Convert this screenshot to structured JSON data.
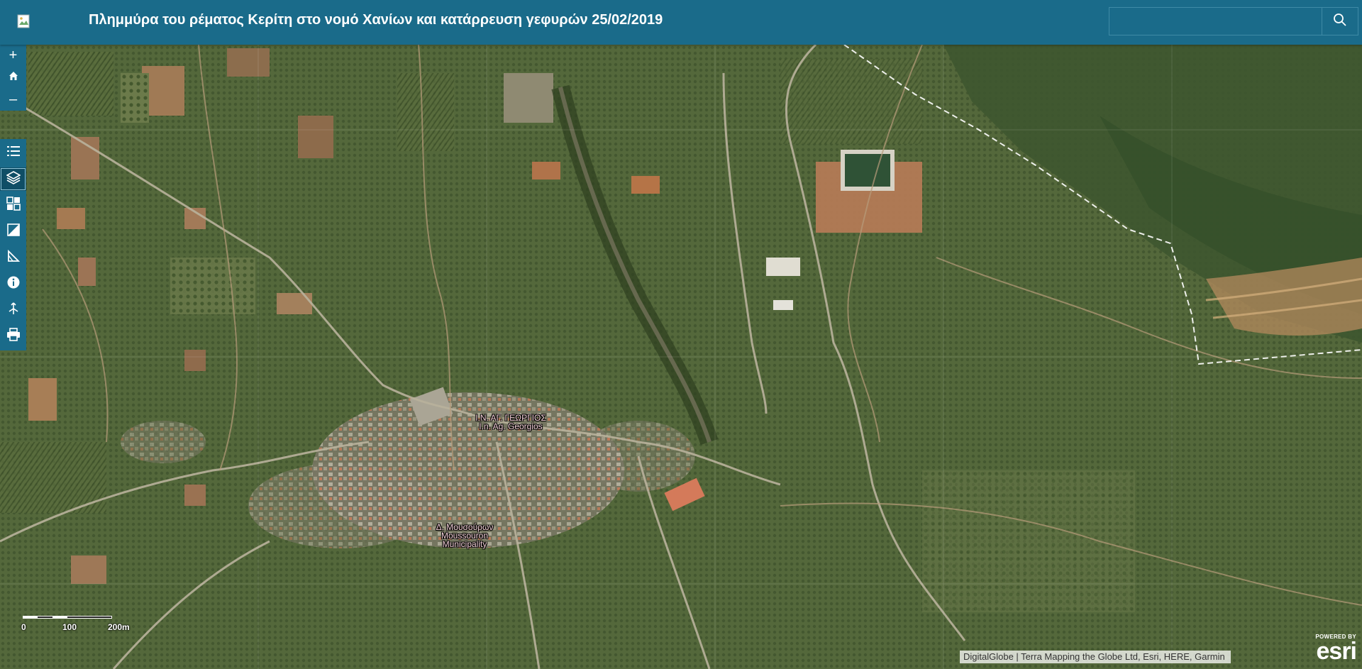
{
  "header": {
    "title": "Πλημμύρα του ρέματος Κερίτη στο νομό Χανίων και κατάρρευση γεφυρών 25/02/2019",
    "logo_icon": "broken-image-icon"
  },
  "search": {
    "value": "",
    "placeholder": "",
    "icon": "search-icon"
  },
  "zoom_controls": {
    "zoom_in_label": "+",
    "home_icon": "home-icon",
    "zoom_out_label": "–"
  },
  "toolbar": {
    "items": [
      {
        "icon": "list-icon",
        "active": false
      },
      {
        "icon": "layers-icon",
        "active": true
      },
      {
        "icon": "basemap-gallery-icon",
        "active": false
      },
      {
        "icon": "swipe-icon",
        "active": false
      },
      {
        "icon": "measure-icon",
        "active": false
      },
      {
        "icon": "info-icon",
        "active": false
      },
      {
        "icon": "directions-icon",
        "active": false
      },
      {
        "icon": "print-icon",
        "active": false
      }
    ]
  },
  "map": {
    "labels": [
      {
        "line1": "Ι.Ν. ΑΓ. ΓΕΩΡΓΙΟΣ",
        "line2": "I.n. Ag. Georgios",
        "line3": ""
      },
      {
        "line1": "Δ. Μουσούρων",
        "line2": "Moussouron",
        "line3": "Municipality"
      }
    ],
    "scale": {
      "tick0": "0",
      "tick1": "100",
      "tick2": "200m"
    },
    "attribution": "DigitalGlobe | Terra Mapping the Globe Ltd, Esri, HERE, Garmin",
    "logo": {
      "powered": "POWERED BY",
      "brand": "esri"
    }
  },
  "colors": {
    "header_bg": "#1a6b8a",
    "header_text": "#ffffff",
    "label_text": "#f4d0d8"
  }
}
